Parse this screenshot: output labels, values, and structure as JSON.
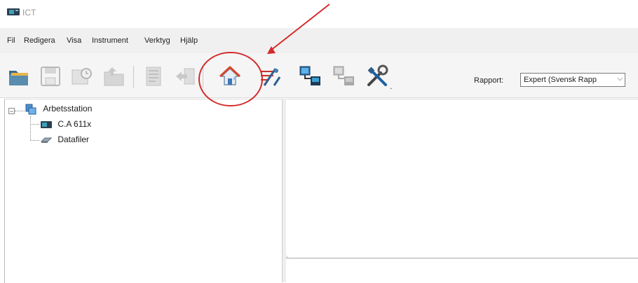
{
  "window": {
    "title": "ICT",
    "icon": "app-device-icon"
  },
  "menu": {
    "items": [
      {
        "label": "Fil"
      },
      {
        "label": "Redigera"
      },
      {
        "label": "Visa"
      },
      {
        "label": "Instrument"
      },
      {
        "label": "Verktyg"
      },
      {
        "label": "Hjälp"
      }
    ]
  },
  "toolbar": {
    "buttons": [
      {
        "icon": "open-folder-icon",
        "enabled": true
      },
      {
        "icon": "save-icon",
        "enabled": false
      },
      {
        "icon": "open-recent-icon",
        "enabled": false
      },
      {
        "icon": "folder-export-icon",
        "enabled": false
      },
      {
        "icon": "print-icon",
        "enabled": false
      },
      {
        "icon": "export-icon",
        "enabled": false
      },
      {
        "icon": "home-icon",
        "enabled": true,
        "highlighted": true
      },
      {
        "icon": "instrument-settings-icon",
        "enabled": true
      },
      {
        "icon": "connect-instrument-icon",
        "enabled": true
      },
      {
        "icon": "disconnect-instrument-icon",
        "enabled": false
      },
      {
        "icon": "tools-icon",
        "enabled": true
      }
    ],
    "report_label": "Rapport:",
    "report_value": "Expert (Svensk Rapp"
  },
  "tree": {
    "root": {
      "label": "Arbetsstation",
      "icon": "workstation-icon",
      "expanded": true
    },
    "children": [
      {
        "label": "C.A 611x",
        "icon": "instrument-icon"
      },
      {
        "label": "Datafiler",
        "icon": "data-files-icon"
      }
    ]
  },
  "annotation": {
    "color": "#d42a2a"
  }
}
